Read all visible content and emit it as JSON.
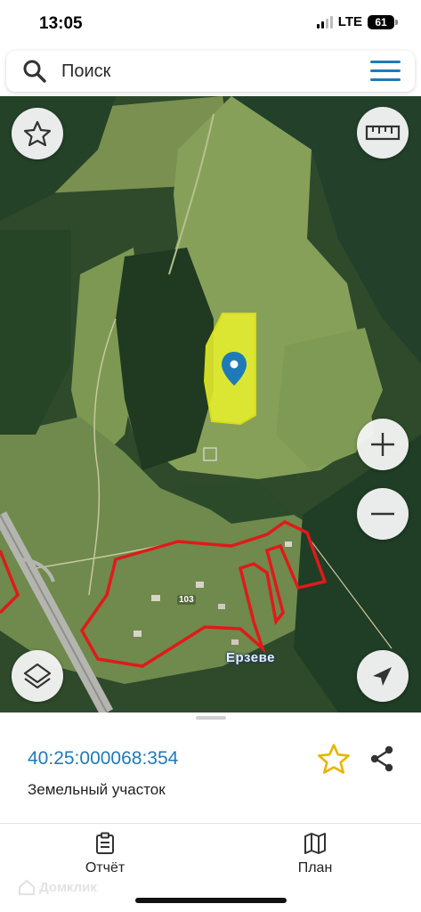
{
  "status_bar": {
    "time": "13:05",
    "network": "LTE",
    "battery": "61"
  },
  "search": {
    "placeholder": "Поиск",
    "icon": "search-icon",
    "menu_icon": "menu-icon"
  },
  "map": {
    "road_number": "103",
    "village_label": "Ерзеве",
    "controls": {
      "favorites": "star-icon",
      "ruler": "ruler-icon",
      "zoom_in": "plus-icon",
      "zoom_out": "minus-icon",
      "layers": "layers-icon",
      "location": "navigation-arrow-icon"
    }
  },
  "parcel": {
    "cadastral_number": "40:25:000068:354",
    "type": "Земельный участок"
  },
  "tabs": [
    {
      "label": "Отчёт",
      "icon": "clipboard-icon"
    },
    {
      "label": "План",
      "icon": "map-icon"
    }
  ],
  "watermark": "Домклик",
  "colors": {
    "accent": "#1f7ab8",
    "favorite": "#e8b400",
    "parcel_fill": "#e7ef2e",
    "boundary": "#e01a1a"
  }
}
